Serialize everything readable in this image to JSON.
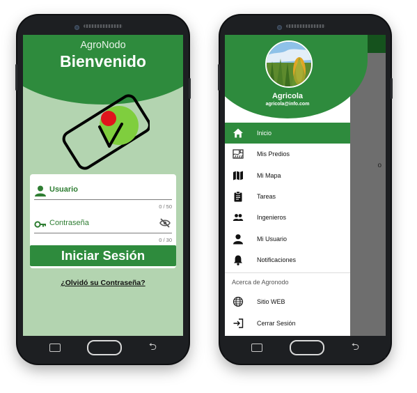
{
  "login_screen": {
    "app_name": "AgroNodo",
    "welcome_title": "Bienvenido",
    "username": {
      "label": "Usuario",
      "counter": "0 / 50"
    },
    "password": {
      "label": "Contraseña",
      "counter": "0 / 30"
    },
    "login_button": "Iniciar Sesión",
    "forgot_link": "¿Olvidó su Contraseña?"
  },
  "drawer_screen": {
    "user_name": "Agricola",
    "user_email": "agricola@info.com",
    "menu": [
      {
        "label": "Inicio",
        "icon": "home-icon",
        "active": true
      },
      {
        "label": "Mis Predios",
        "icon": "farm-icon",
        "active": false
      },
      {
        "label": "Mi Mapa",
        "icon": "map-icon",
        "active": false
      },
      {
        "label": "Tareas",
        "icon": "clipboard-icon",
        "active": false
      },
      {
        "label": "Ingenieros",
        "icon": "people-icon",
        "active": false
      },
      {
        "label": "Mi Usuario",
        "icon": "person-icon",
        "active": false
      },
      {
        "label": "Notificaciones",
        "icon": "bell-icon",
        "active": false
      }
    ],
    "section_title": "Acerca de Agronodo",
    "secondary_menu": [
      {
        "label": "Sitio WEB",
        "icon": "globe-icon"
      },
      {
        "label": "Cerrar Sesión",
        "icon": "logout-icon"
      }
    ],
    "background_text": "o"
  },
  "colors": {
    "primary_green": "#2e8b3d",
    "dark_green": "#15521d",
    "login_background": "#b3d4b0",
    "logo_red": "#e0141c",
    "logo_light_green": "#7fce3e"
  }
}
